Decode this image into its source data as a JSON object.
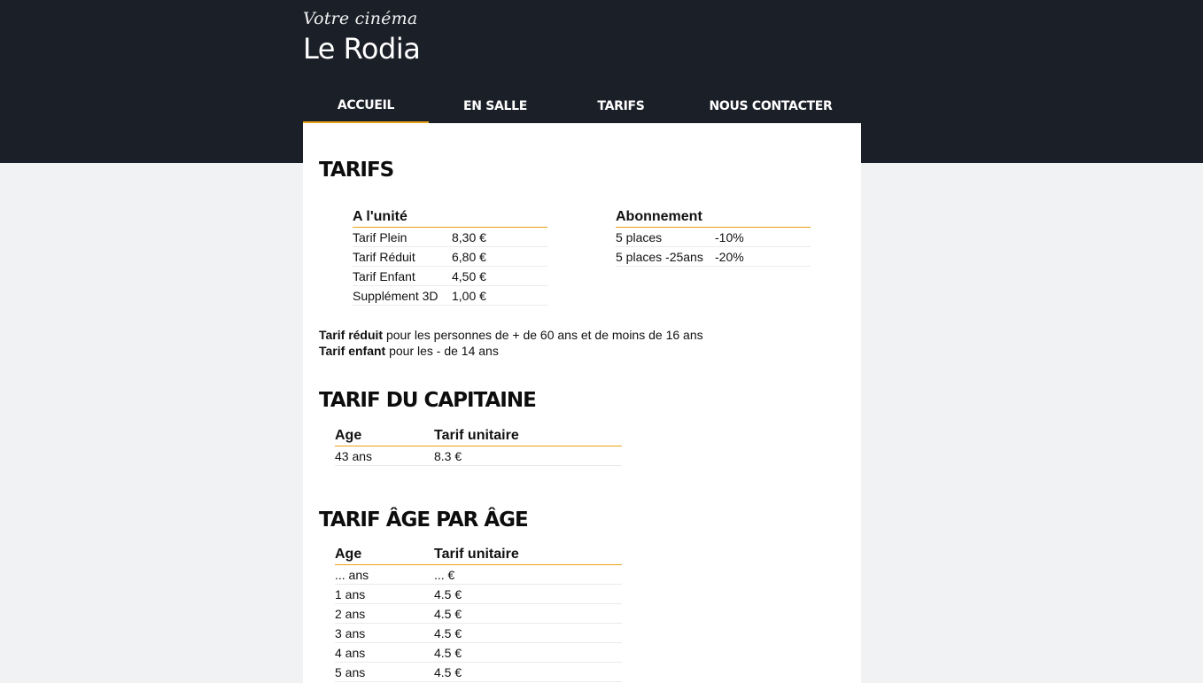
{
  "header": {
    "subtitle": "Votre cinéma",
    "title": "Le Rodia"
  },
  "nav": {
    "items": [
      {
        "label": "ACCUEIL",
        "active": true
      },
      {
        "label": "EN SALLE",
        "active": false
      },
      {
        "label": "TARIFS",
        "active": false
      },
      {
        "label": "NOUS CONTACTER",
        "active": false
      }
    ]
  },
  "accent_color": "#e8a317",
  "tarifs": {
    "heading": "TARIFS",
    "unite": {
      "title": "A l'unité",
      "rows": [
        {
          "label": "Tarif Plein",
          "value": "8,30 €"
        },
        {
          "label": "Tarif Réduit",
          "value": "6,80 €"
        },
        {
          "label": "Tarif Enfant",
          "value": "4,50 €"
        },
        {
          "label": "Supplément 3D",
          "value": "1,00 €"
        }
      ]
    },
    "abonnement": {
      "title": "Abonnement",
      "rows": [
        {
          "label": "5 places",
          "value": "-10%"
        },
        {
          "label": "5 places -25ans",
          "value": "-20%"
        }
      ]
    },
    "notes": [
      {
        "bold": "Tarif réduit",
        "text": " pour les personnes de + de 60 ans et de moins de 16 ans"
      },
      {
        "bold": "Tarif enfant",
        "text": " pour les - de 14 ans"
      }
    ]
  },
  "capitaine": {
    "heading": "TARIF DU CAPITAINE",
    "columns": [
      "Age",
      "Tarif unitaire"
    ],
    "rows": [
      {
        "age": "43 ans",
        "tarif": "8.3 €"
      }
    ]
  },
  "age_par_age": {
    "heading": "TARIF ÂGE PAR ÂGE",
    "columns": [
      "Age",
      "Tarif unitaire"
    ],
    "rows": [
      {
        "age": "... ans",
        "tarif": "... €"
      },
      {
        "age": "1 ans",
        "tarif": "4.5 €"
      },
      {
        "age": "2 ans",
        "tarif": "4.5 €"
      },
      {
        "age": "3 ans",
        "tarif": "4.5 €"
      },
      {
        "age": "4 ans",
        "tarif": "4.5 €"
      },
      {
        "age": "5 ans",
        "tarif": "4.5 €"
      }
    ]
  }
}
